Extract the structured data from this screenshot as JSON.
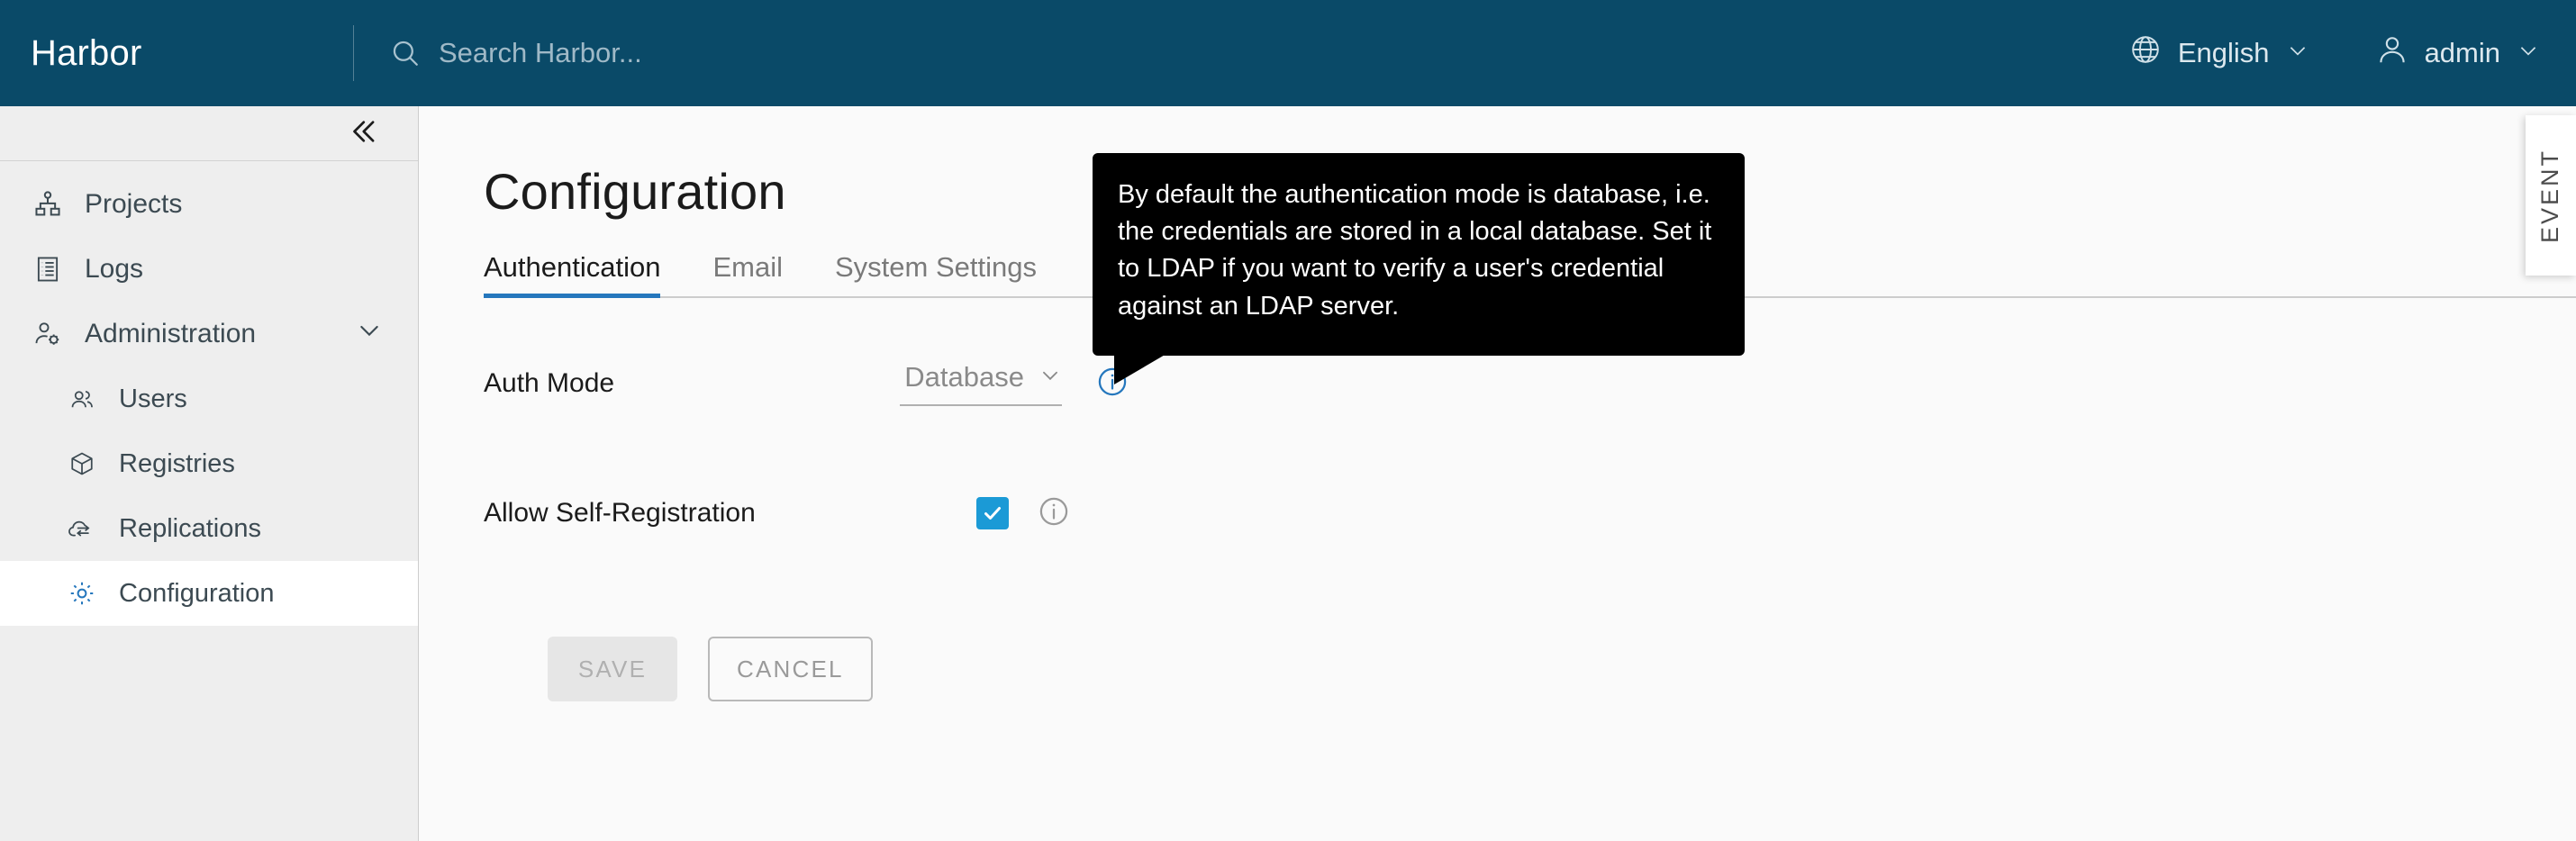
{
  "header": {
    "brand": "Harbor",
    "search": {
      "placeholder": "Search Harbor...",
      "value": "",
      "icon": "search-icon"
    },
    "language": {
      "label": "English",
      "icon": "globe-icon",
      "chevron": "chevron-down-icon"
    },
    "account": {
      "label": "admin",
      "icon": "user-icon",
      "chevron": "chevron-down-icon"
    },
    "background_color": "#0a4a68"
  },
  "sidebar": {
    "collapse_icon": "double-chevron-left-icon",
    "items": [
      {
        "label": "Projects",
        "icon": "projects-icon",
        "level": 0,
        "active": false
      },
      {
        "label": "Logs",
        "icon": "logs-icon",
        "level": 0,
        "active": false
      },
      {
        "label": "Administration",
        "icon": "administration-icon",
        "level": 0,
        "active": false,
        "expanded": true,
        "chevron": "chevron-down-icon"
      },
      {
        "label": "Users",
        "icon": "users-icon",
        "level": 1,
        "active": false
      },
      {
        "label": "Registries",
        "icon": "registries-icon",
        "level": 1,
        "active": false
      },
      {
        "label": "Replications",
        "icon": "replications-icon",
        "level": 1,
        "active": false
      },
      {
        "label": "Configuration",
        "icon": "gear-icon",
        "level": 1,
        "active": true
      }
    ]
  },
  "main": {
    "page_title": "Configuration",
    "tabs": [
      {
        "label": "Authentication",
        "active": true
      },
      {
        "label": "Email",
        "active": false
      },
      {
        "label": "System Settings",
        "active": false
      }
    ],
    "form": {
      "auth_mode": {
        "label": "Auth Mode",
        "value": "Database",
        "chevron": "chevron-down-icon",
        "info_icon": "info-icon"
      },
      "self_registration": {
        "label": "Allow Self-Registration",
        "checked": true,
        "check_icon": "check-icon",
        "info_icon": "info-icon"
      }
    },
    "buttons": {
      "save": "SAVE",
      "cancel": "CANCEL"
    }
  },
  "tooltip": {
    "text": "By default the authentication mode is database, i.e. the credentials are stored in a local database. Set it to LDAP if you want to verify a user's credential against an LDAP server."
  },
  "event_tab": {
    "label": "EVENT"
  },
  "colors": {
    "header_bg": "#0a4a68",
    "accent_blue": "#2577bd",
    "checkbox_blue": "#1b9ad6",
    "sidebar_bg": "#eeeeee",
    "content_bg": "#fafafa",
    "tooltip_bg": "#000000"
  }
}
